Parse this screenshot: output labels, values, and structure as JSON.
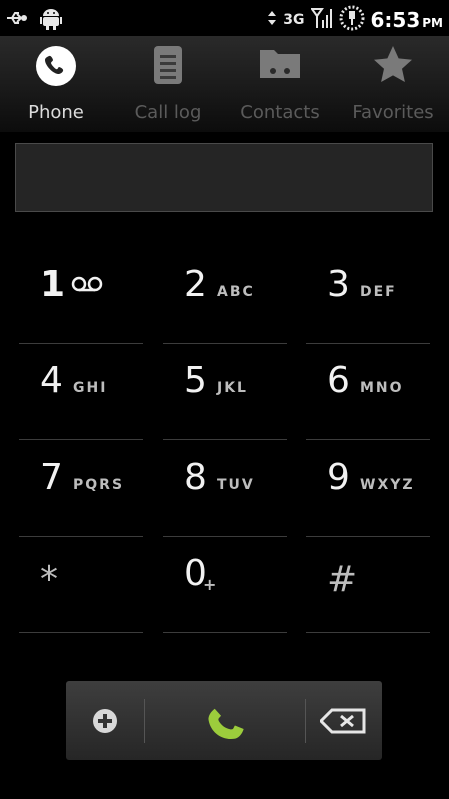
{
  "status_bar": {
    "network": "3G",
    "time": "6:53",
    "ampm": "PM",
    "icons": [
      "usb-icon",
      "android-debug-icon",
      "data-arrows-icon",
      "signal-icon",
      "battery-charging-icon"
    ]
  },
  "tabs": [
    {
      "label": "Phone",
      "icon": "phone-icon",
      "active": true
    },
    {
      "label": "Call log",
      "icon": "call-log-icon",
      "active": false
    },
    {
      "label": "Contacts",
      "icon": "contacts-icon",
      "active": false
    },
    {
      "label": "Favorites",
      "icon": "star-icon",
      "active": false
    }
  ],
  "number_field": {
    "value": ""
  },
  "keypad": [
    {
      "digit": "1",
      "letters": "",
      "voicemail": true
    },
    {
      "digit": "2",
      "letters": "ABC"
    },
    {
      "digit": "3",
      "letters": "DEF"
    },
    {
      "digit": "4",
      "letters": "GHI"
    },
    {
      "digit": "5",
      "letters": "JKL"
    },
    {
      "digit": "6",
      "letters": "MNO"
    },
    {
      "digit": "7",
      "letters": "PQRS"
    },
    {
      "digit": "8",
      "letters": "TUV"
    },
    {
      "digit": "9",
      "letters": "WXYZ"
    },
    {
      "digit": "*",
      "letters": ""
    },
    {
      "digit": "0",
      "letters": "+"
    },
    {
      "digit": "#",
      "letters": ""
    }
  ],
  "actions": {
    "add_icon": "add-contact-icon",
    "call_icon": "call-icon",
    "delete_icon": "backspace-icon",
    "call_color": "#9ccc3c"
  }
}
